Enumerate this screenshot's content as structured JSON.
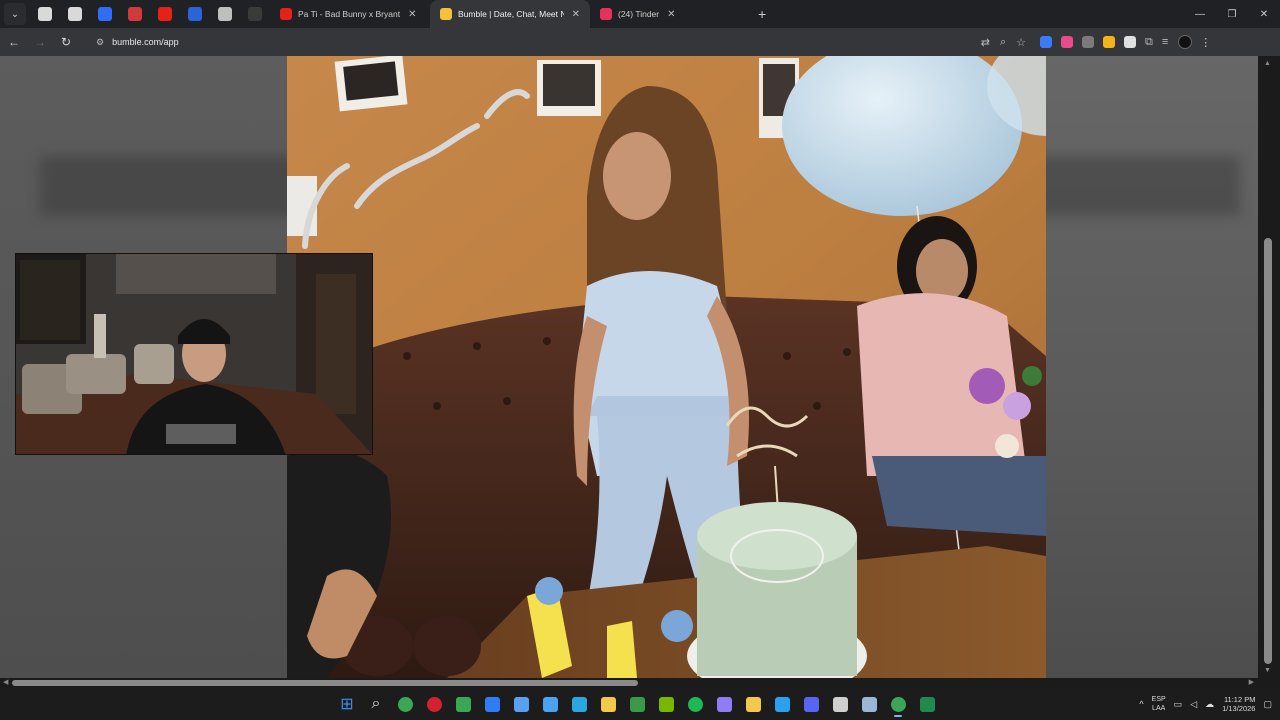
{
  "browser": {
    "menu_icon": "chevron-down",
    "pinned_tabs": [
      {
        "icon": "docs-icon",
        "color": "#d9d9d9"
      },
      {
        "icon": "docs-icon",
        "color": "#d9d9d9"
      },
      {
        "icon": "c-app-icon",
        "color": "#2f6df6"
      },
      {
        "icon": "app-icon",
        "color": "#d03a3a"
      },
      {
        "icon": "youtube-icon",
        "color": "#e62117"
      },
      {
        "icon": "meta-icon",
        "color": "#2a64d8"
      },
      {
        "icon": "tools-icon",
        "color": "#bfbfbf"
      },
      {
        "icon": "blank-icon",
        "color": "#3a3a3a"
      }
    ],
    "tabs": [
      {
        "title": "Pa Ti - Bad Bunny x Bryant",
        "favicon_color": "#e62117",
        "active": false
      },
      {
        "title": "Bumble | Date, Chat, Meet New",
        "favicon_color": "#f6c13a",
        "active": true
      },
      {
        "title": "(24) Tinder",
        "favicon_color": "#e8315a",
        "active": false
      }
    ],
    "close_glyph": "✕",
    "new_tab_glyph": "+",
    "window_controls": [
      "—",
      "❐",
      "✕"
    ],
    "address": "bumble.com/app",
    "extensions": [
      {
        "icon": "translate-icon",
        "color": "#bcbcbc"
      },
      {
        "icon": "zoom-icon",
        "color": "#bcbcbc"
      },
      {
        "icon": "bookmark-star-icon",
        "color": "#bcbcbc"
      },
      {
        "icon": "extension-a-icon",
        "color": "#3a7cf6"
      },
      {
        "icon": "extension-b-icon",
        "color": "#e64b8b"
      },
      {
        "icon": "extension-c-icon",
        "color": "#7a7a7a"
      },
      {
        "icon": "extension-d-icon",
        "color": "#f2b418"
      },
      {
        "icon": "extension-e-icon",
        "color": "#e0e0e0"
      },
      {
        "icon": "puzzle-icon",
        "color": "#bcbcbc"
      },
      {
        "icon": "reading-list-icon",
        "color": "#bcbcbc"
      }
    ]
  },
  "photo": {
    "description_alt": "",
    "next_glyph": "›"
  },
  "taskbar": {
    "apps": [
      {
        "icon": "windows-start-icon",
        "color": "#3d8cf0"
      },
      {
        "icon": "search-icon",
        "color": "#e0e0e0"
      },
      {
        "icon": "chrome-icon",
        "color": "#3aa757"
      },
      {
        "icon": "opera-icon",
        "color": "#d3212d"
      },
      {
        "icon": "app-icon",
        "color": "#3aa757"
      },
      {
        "icon": "defender-icon",
        "color": "#2f7cf6"
      },
      {
        "icon": "app-icon",
        "color": "#5aa0f0"
      },
      {
        "icon": "photos-icon",
        "color": "#4aa3f0"
      },
      {
        "icon": "app-icon",
        "color": "#2aa7e0"
      },
      {
        "icon": "file-explorer-icon",
        "color": "#f2c94c"
      },
      {
        "icon": "app-icon",
        "color": "#3a9a4a"
      },
      {
        "icon": "nvidia-icon",
        "color": "#76b900"
      },
      {
        "icon": "spotify-icon",
        "color": "#1db954"
      },
      {
        "icon": "app-icon",
        "color": "#8f7cf6"
      },
      {
        "icon": "app-icon",
        "color": "#f2c94c"
      },
      {
        "icon": "vscode-icon",
        "color": "#2aa0f0"
      },
      {
        "icon": "discord-icon",
        "color": "#5865f2"
      },
      {
        "icon": "app-icon",
        "color": "#cfcfcf"
      },
      {
        "icon": "steam-icon",
        "color": "#9ab7d6"
      },
      {
        "icon": "chrome-icon",
        "color": "#3aa757"
      },
      {
        "icon": "excel-icon",
        "color": "#1f8a4c"
      }
    ],
    "tray": {
      "chevron": "^",
      "lang_top": "ESP",
      "lang_bottom": "LAA",
      "time": "11:12 PM",
      "date": "1/13/2026"
    }
  }
}
